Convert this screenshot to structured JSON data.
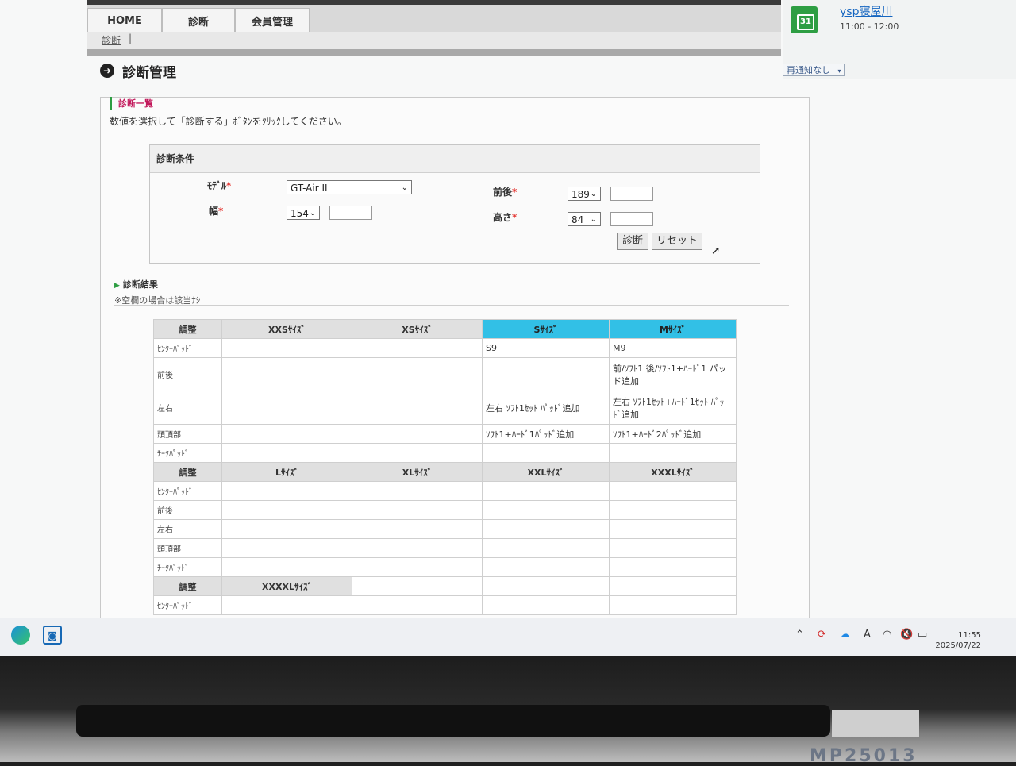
{
  "nav": {
    "tabs": [
      "HOME",
      "診断",
      "会員管理"
    ]
  },
  "breadcrumb": {
    "current": "診断",
    "separator": "|"
  },
  "page": {
    "title": "診断管理"
  },
  "list": {
    "heading": "診断一覧",
    "instruction": "数値を選択して「診断する」ﾎﾞﾀﾝをｸﾘｯｸしてください。"
  },
  "conditions": {
    "heading": "診断条件",
    "required_mark": "*",
    "model_label": "ﾓﾃﾞﾙ",
    "model_value": "GT-Air II",
    "width_label": "幅",
    "width_value": "154",
    "fb_label": "前後",
    "fb_value": "189",
    "height_label": "高さ",
    "height_value": "84",
    "diagnose_button": "診断",
    "reset_button": "リセット"
  },
  "results": {
    "heading": "診断結果",
    "note": "※空欄の場合は該当ﾅｼ",
    "row_labels": [
      "ｾﾝﾀｰﾊﾟｯﾄﾞ",
      "前後",
      "左右",
      "頭頂部",
      "ﾁｰｸﾊﾟｯﾄﾞ"
    ],
    "group1": {
      "headers": [
        "調整",
        "XXSｻｲｽﾞ",
        "XSｻｲｽﾞ",
        "Sｻｲｽﾞ",
        "Mｻｲｽﾞ"
      ],
      "rows": [
        [
          "",
          "",
          "S9",
          "M9"
        ],
        [
          "",
          "",
          "",
          "前/ｿﾌﾄ1 後/ｿﾌﾄ1+ﾊｰﾄﾞ1 パッド追加"
        ],
        [
          "",
          "",
          "左右 ｿﾌﾄ1ｾｯﾄ ﾊﾟｯﾄﾞ追加",
          "左右 ｿﾌﾄ1ｾｯﾄ+ﾊｰﾄﾞ1ｾｯﾄ ﾊﾟｯﾄﾞ追加"
        ],
        [
          "",
          "",
          "ｿﾌﾄ1+ﾊｰﾄﾞ1ﾊﾟｯﾄﾞ追加",
          "ｿﾌﾄ1+ﾊｰﾄﾞ2ﾊﾟｯﾄﾞ追加"
        ],
        [
          "",
          "",
          "",
          ""
        ]
      ]
    },
    "group2": {
      "headers": [
        "調整",
        "Lｻｲｽﾞ",
        "XLｻｲｽﾞ",
        "XXLｻｲｽﾞ",
        "XXXLｻｲｽﾞ"
      ]
    },
    "group3": {
      "headers": [
        "調整",
        "XXXXLｻｲｽﾞ"
      ]
    }
  },
  "notification": {
    "date_icon": "31",
    "title": "ysp寝屋川",
    "time": "11:00 - 12:00",
    "snooze": "再通知なし"
  },
  "taskbar": {
    "ime": "A",
    "time": "11:55",
    "date": "2025/07/22"
  },
  "hardware": {
    "label": "MP25013"
  },
  "colors": {
    "highlight": "#32c0e6",
    "accent_green": "#2e9e43",
    "required": "#e53935"
  }
}
